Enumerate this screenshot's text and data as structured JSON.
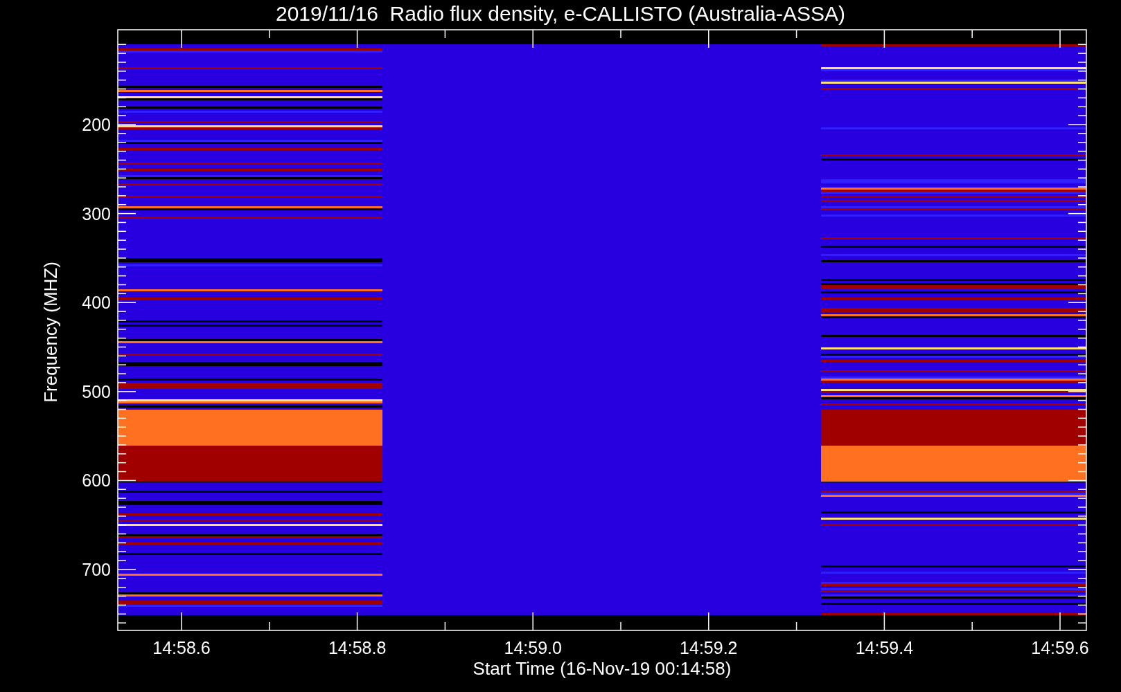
{
  "title": "2019/11/16  Radio flux density, e-CALLISTO (Australia-ASSA)",
  "y_axis": {
    "label": "Frequency (MHZ)",
    "ticks": [
      "200",
      "300",
      "400",
      "500",
      "600",
      "700"
    ]
  },
  "x_axis": {
    "label": "Start Time (16-Nov-19 00:14:58)",
    "ticks": [
      "14:58.6",
      "14:58.8",
      "14:59.0",
      "14:59.2",
      "14:59.4",
      "14:59.6"
    ]
  }
}
